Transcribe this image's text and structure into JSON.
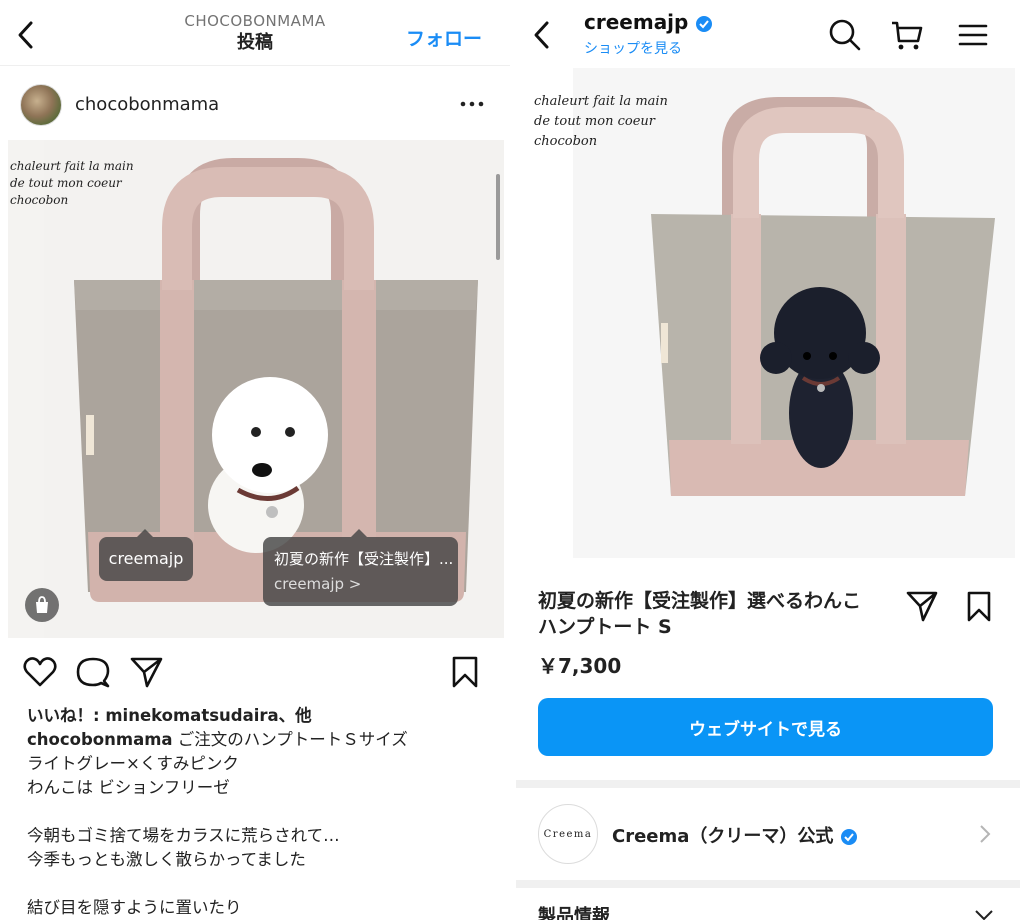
{
  "left": {
    "header": {
      "supertitle": "CHOCOBONMAMA",
      "title": "投稿",
      "follow_label": "フォロー"
    },
    "post": {
      "username": "chocobonmama",
      "watermark": [
        "chaleurt fait la main",
        "de tout mon coeur",
        "chocobon"
      ],
      "tags": [
        {
          "label": "creemajp"
        },
        {
          "label": "初夏の新作【受注製作】...",
          "sub": "creemajp >"
        }
      ]
    },
    "caption": {
      "likes": "いいね！: minekomatsudaira、他",
      "author": "chocobonmama",
      "first_line": " ご注文のハンプトートＳサイズ",
      "lines": [
        "ライトグレー×くすみピンク",
        "わんこは ビションフリーゼ"
      ],
      "para2": [
        "今朝もゴミ捨て場をカラスに荒らされて…",
        "今季もっとも激しく散らかってました"
      ],
      "para3": [
        "結び目を隠すように置いたり"
      ]
    }
  },
  "right": {
    "header": {
      "shop_name": "creemajp",
      "shop_link": "ショップを見る"
    },
    "watermark": [
      "chaleurt fait la main",
      "de tout mon coeur",
      "chocobon"
    ],
    "product": {
      "title": "初夏の新作【受注製作】選べるわんこ ハンプトート S",
      "price": "￥7,300",
      "cta": "ウェブサイトで見る"
    },
    "seller": {
      "logo_text": "Creema",
      "name": "Creema（クリーマ）公式"
    },
    "section_title": "製品情報"
  },
  "colors": {
    "accent": "#1a8cf5",
    "button": "#0a95f6",
    "bag_gray": "#a9a198",
    "bag_pink": "#d7b8b1"
  }
}
